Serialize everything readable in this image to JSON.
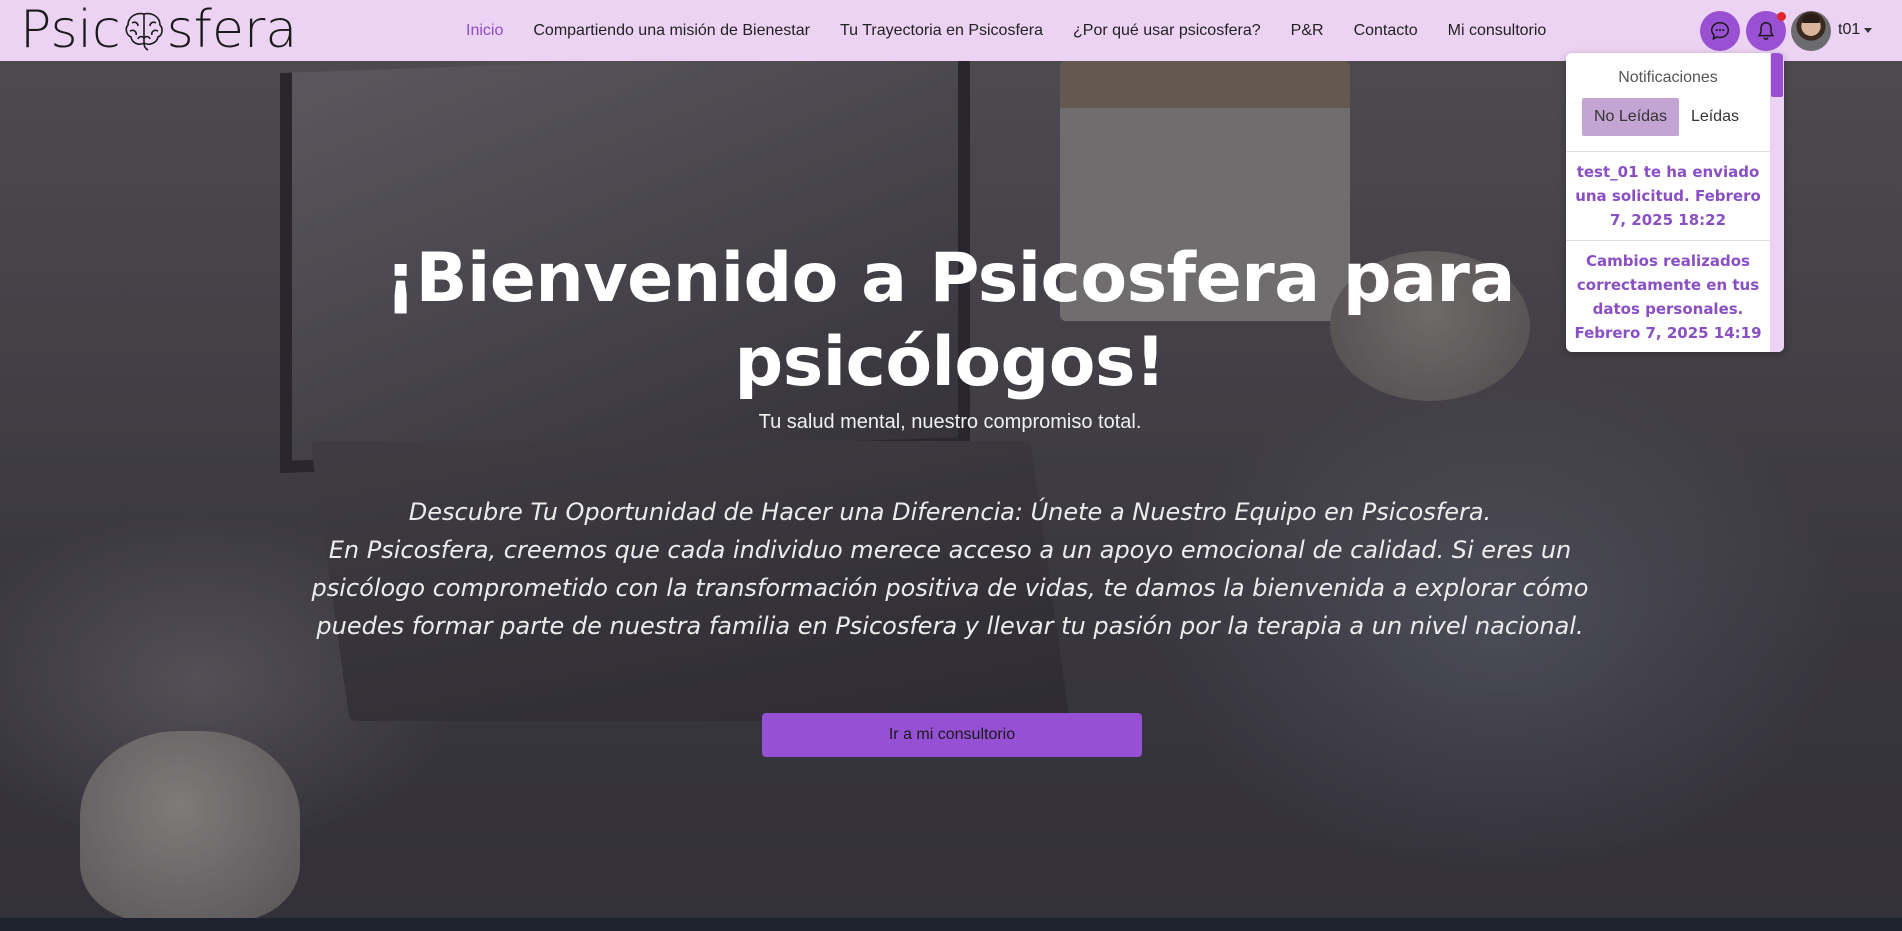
{
  "brand": {
    "logo_left": "Psic",
    "logo_right": "sfera"
  },
  "nav": {
    "links": [
      {
        "label": "Inicio",
        "active": true
      },
      {
        "label": "Compartiendo una misión de Bienestar"
      },
      {
        "label": "Tu Trayectoria en Psicosfera"
      },
      {
        "label": "¿Por qué usar psicosfera?"
      },
      {
        "label": "P&R"
      },
      {
        "label": "Contacto"
      },
      {
        "label": "Mi consultorio"
      }
    ],
    "user_name": "t01"
  },
  "hero": {
    "title": "¡Bienvenido a Psicosfera para psicólogos!",
    "subtitle": "Tu salud mental, nuestro compromiso total.",
    "desc_line1": "Descubre Tu Oportunidad de Hacer una Diferencia: Únete a Nuestro Equipo en Psicosfera.",
    "desc_line2": "En Psicosfera, creemos que cada individuo merece acceso a un apoyo emocional de calidad. Si eres un psicólogo comprometido con la transformación positiva de vidas, te damos la bienvenida a explorar cómo puedes formar parte de nuestra familia en Psicosfera y llevar tu pasión por la terapia a un nivel nacional.",
    "cta": "Ir a mi consultorio"
  },
  "notifications": {
    "title": "Notificaciones",
    "tab_unread": "No Leídas",
    "tab_read": "Leídas",
    "items": [
      "test_01 te ha enviado una solicitud. Febrero 7, 2025 18:22",
      "Cambios realizados correctamente en tus datos personales. Febrero 7, 2025 14:19"
    ]
  },
  "colors": {
    "accent": "#9a50d2",
    "nav_bg": "#ecd3f3",
    "active_link": "#8a4fc4",
    "badge": "#e3262d"
  },
  "icons": [
    "brain-icon",
    "chat-icon",
    "bell-icon",
    "caret-down-icon"
  ]
}
